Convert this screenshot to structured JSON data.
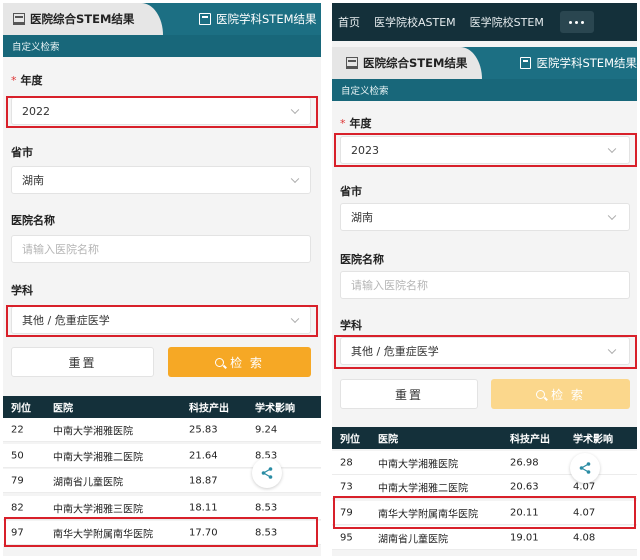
{
  "left": {
    "tabs": [
      {
        "label": "医院综合STEM结果",
        "active": true,
        "icon": "hospital-icon"
      },
      {
        "label": "医院学科STEM结果",
        "active": false,
        "icon": "book-icon"
      }
    ],
    "subbar_label": "自定义检索",
    "form": {
      "year_label": "年度",
      "year_value": "2022",
      "province_label": "省市",
      "province_value": "湖南",
      "hospital_label": "医院名称",
      "hospital_placeholder": "请输入医院名称",
      "subject_label": "学科",
      "subject_value": "其他 / 危重症医学"
    },
    "buttons": {
      "reset": "重置",
      "search": "检 索"
    },
    "table": {
      "headers": [
        "列位",
        "医院",
        "科技产出",
        "学术影响"
      ],
      "rows": [
        [
          "22",
          "中南大学湘雅医院",
          "25.83",
          "9.24"
        ],
        [
          "50",
          "中南大学湘雅二医院",
          "21.64",
          "8.53"
        ],
        [
          "79",
          "湖南省儿童医院",
          "18.87",
          ""
        ],
        [
          "82",
          "中南大学湘雅三医院",
          "18.11",
          "8.53"
        ],
        [
          "97",
          "南华大学附属南华医院",
          "17.70",
          "8.53"
        ]
      ]
    }
  },
  "right": {
    "nav": [
      "首页",
      "医学院校ASTEM",
      "医学院校STEM"
    ],
    "tabs": [
      {
        "label": "医院综合STEM结果",
        "active": true,
        "icon": "hospital-icon"
      },
      {
        "label": "医院学科STEM结果",
        "active": false,
        "icon": "book-icon"
      }
    ],
    "subbar_label": "自定义检索",
    "form": {
      "year_label": "年度",
      "year_value": "2023",
      "province_label": "省市",
      "province_value": "湖南",
      "hospital_label": "医院名称",
      "hospital_placeholder": "请输入医院名称",
      "subject_label": "学科",
      "subject_value": "其他 / 危重症医学"
    },
    "buttons": {
      "reset": "重置",
      "search": "检 索"
    },
    "table": {
      "headers": [
        "列位",
        "医院",
        "科技产出",
        "学术影响"
      ],
      "rows": [
        [
          "28",
          "中南大学湘雅医院",
          "26.98",
          ""
        ],
        [
          "73",
          "中南大学湘雅二医院",
          "20.63",
          "4.07"
        ],
        [
          "79",
          "南华大学附属南华医院",
          "20.11",
          "4.07"
        ],
        [
          "95",
          "湖南省儿童医院",
          "19.01",
          "4.08"
        ]
      ]
    }
  },
  "colors": {
    "tab_bar": "#1c6f83",
    "nav_bar": "#14303a",
    "table_header": "#14303a",
    "search_button": "#f6a825",
    "highlight": "#d8202a",
    "required": "#d33"
  }
}
